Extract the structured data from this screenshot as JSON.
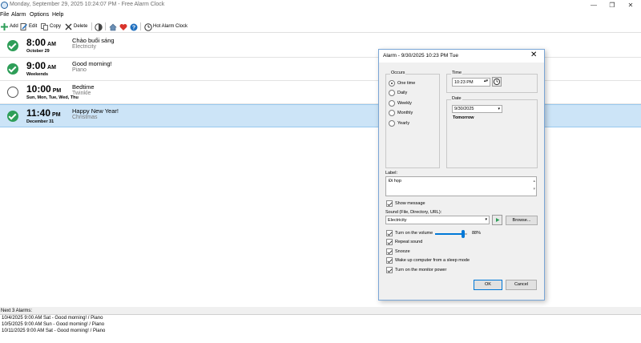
{
  "window": {
    "title": "Monday, September 29, 2025 10:24:07 PM - Free Alarm Clock",
    "icon": "alarm-clock-icon",
    "controls": {
      "minimize": "—",
      "maximize": "❐",
      "close": "✕"
    }
  },
  "menu": {
    "file": "File",
    "alarm": "Alarm",
    "options": "Options",
    "help": "Help"
  },
  "toolbar": {
    "add": "Add",
    "edit": "Edit",
    "copy": "Copy",
    "delete": "Delete",
    "hot_alarm_clock": "Hot Alarm Clock"
  },
  "alarms": [
    {
      "enabled": true,
      "time": "8:00",
      "ampm": "AM",
      "repeat": "October 29",
      "label": "Chào buổi sáng",
      "sound": "Electricity"
    },
    {
      "enabled": true,
      "time": "9:00",
      "ampm": "AM",
      "repeat": "Weekends",
      "label": "Good morning!",
      "sound": "Piano"
    },
    {
      "enabled": false,
      "time": "10:00",
      "ampm": "PM",
      "repeat": "Sun, Mon, Tue, Wed, Thu",
      "label": "Bedtime",
      "sound": "Twinkle"
    },
    {
      "enabled": true,
      "time": "11:40",
      "ampm": "PM",
      "repeat": "December 31",
      "label": "Happy New Year!",
      "sound": "Christmas",
      "selected": true
    }
  ],
  "next_alarms": {
    "heading": "Next 3 Alarms:",
    "items": [
      "10/4/2025 9:00 AM Sat - Good morning! / Piano",
      "10/5/2025 9:00 AM Sun - Good morning! / Piano",
      "10/11/2025 9:00 AM Sat - Good morning! / Piano"
    ]
  },
  "dialog": {
    "title": "Alarm - 9/30/2025 10:23 PM Tue",
    "close": "✕",
    "occurs": {
      "title": "Occurs",
      "options": [
        "One time",
        "Daily",
        "Weekly",
        "Monthly",
        "Yearly"
      ],
      "selected": "One time"
    },
    "time": {
      "title": "Time",
      "value": "10:23 PM"
    },
    "date": {
      "title": "Date",
      "value": "9/30/2025",
      "relative": "Tomorrow"
    },
    "label": {
      "title": "Label:",
      "value": "Đi họp"
    },
    "show_message": {
      "text": "Show message",
      "checked": true
    },
    "sound": {
      "title": "Sound (File, Directory, URL):",
      "value": "Electricity",
      "browse": "Browse..."
    },
    "volume": {
      "text": "Turn on the volume",
      "percent": 88,
      "display": "88%"
    },
    "options": [
      {
        "text": "Repeat sound",
        "checked": true
      },
      {
        "text": "Snooze",
        "checked": true
      },
      {
        "text": "Wake up computer from a sleep mode",
        "checked": true
      },
      {
        "text": "Turn on the monitor power",
        "checked": true
      }
    ],
    "ok": "OK",
    "cancel": "Cancel"
  },
  "colors": {
    "accent": "#0078d7",
    "enabled_check": "#2e9e58",
    "selected_row": "#cce4f7"
  }
}
